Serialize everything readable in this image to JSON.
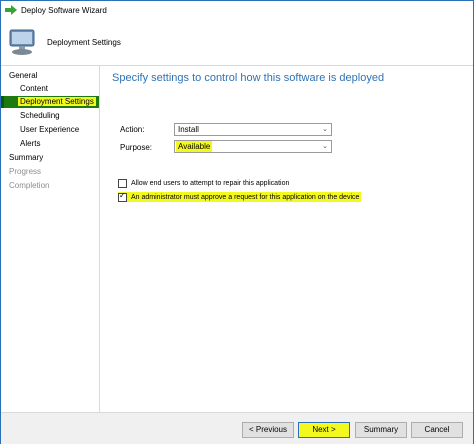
{
  "window": {
    "title": "Deploy Software Wizard"
  },
  "header": {
    "page_name": "Deployment Settings"
  },
  "sidebar": {
    "items": [
      {
        "label": "General",
        "state": "normal"
      },
      {
        "label": "Content",
        "state": "normal"
      },
      {
        "label": "Deployment Settings",
        "state": "active"
      },
      {
        "label": "Scheduling",
        "state": "normal"
      },
      {
        "label": "User Experience",
        "state": "normal"
      },
      {
        "label": "Alerts",
        "state": "normal"
      },
      {
        "label": "Summary",
        "state": "normal"
      },
      {
        "label": "Progress",
        "state": "disabled"
      },
      {
        "label": "Completion",
        "state": "disabled"
      }
    ]
  },
  "main": {
    "heading": "Specify settings to control how this software is deployed",
    "action_label": "Action:",
    "action_value": "Install",
    "purpose_label": "Purpose:",
    "purpose_value": "Available",
    "checkbox_repair": {
      "label": "Allow end users to attempt to repair this application",
      "checked": false
    },
    "checkbox_approve": {
      "label": "An administrator must approve a request for this application on the device",
      "checked": true
    }
  },
  "footer": {
    "previous": "< Previous",
    "next": "Next >",
    "summary": "Summary",
    "cancel": "Cancel"
  },
  "colors": {
    "accent": "#2f73b6",
    "highlight": "#f3f91e",
    "active_nav": "#1e7a0e"
  }
}
